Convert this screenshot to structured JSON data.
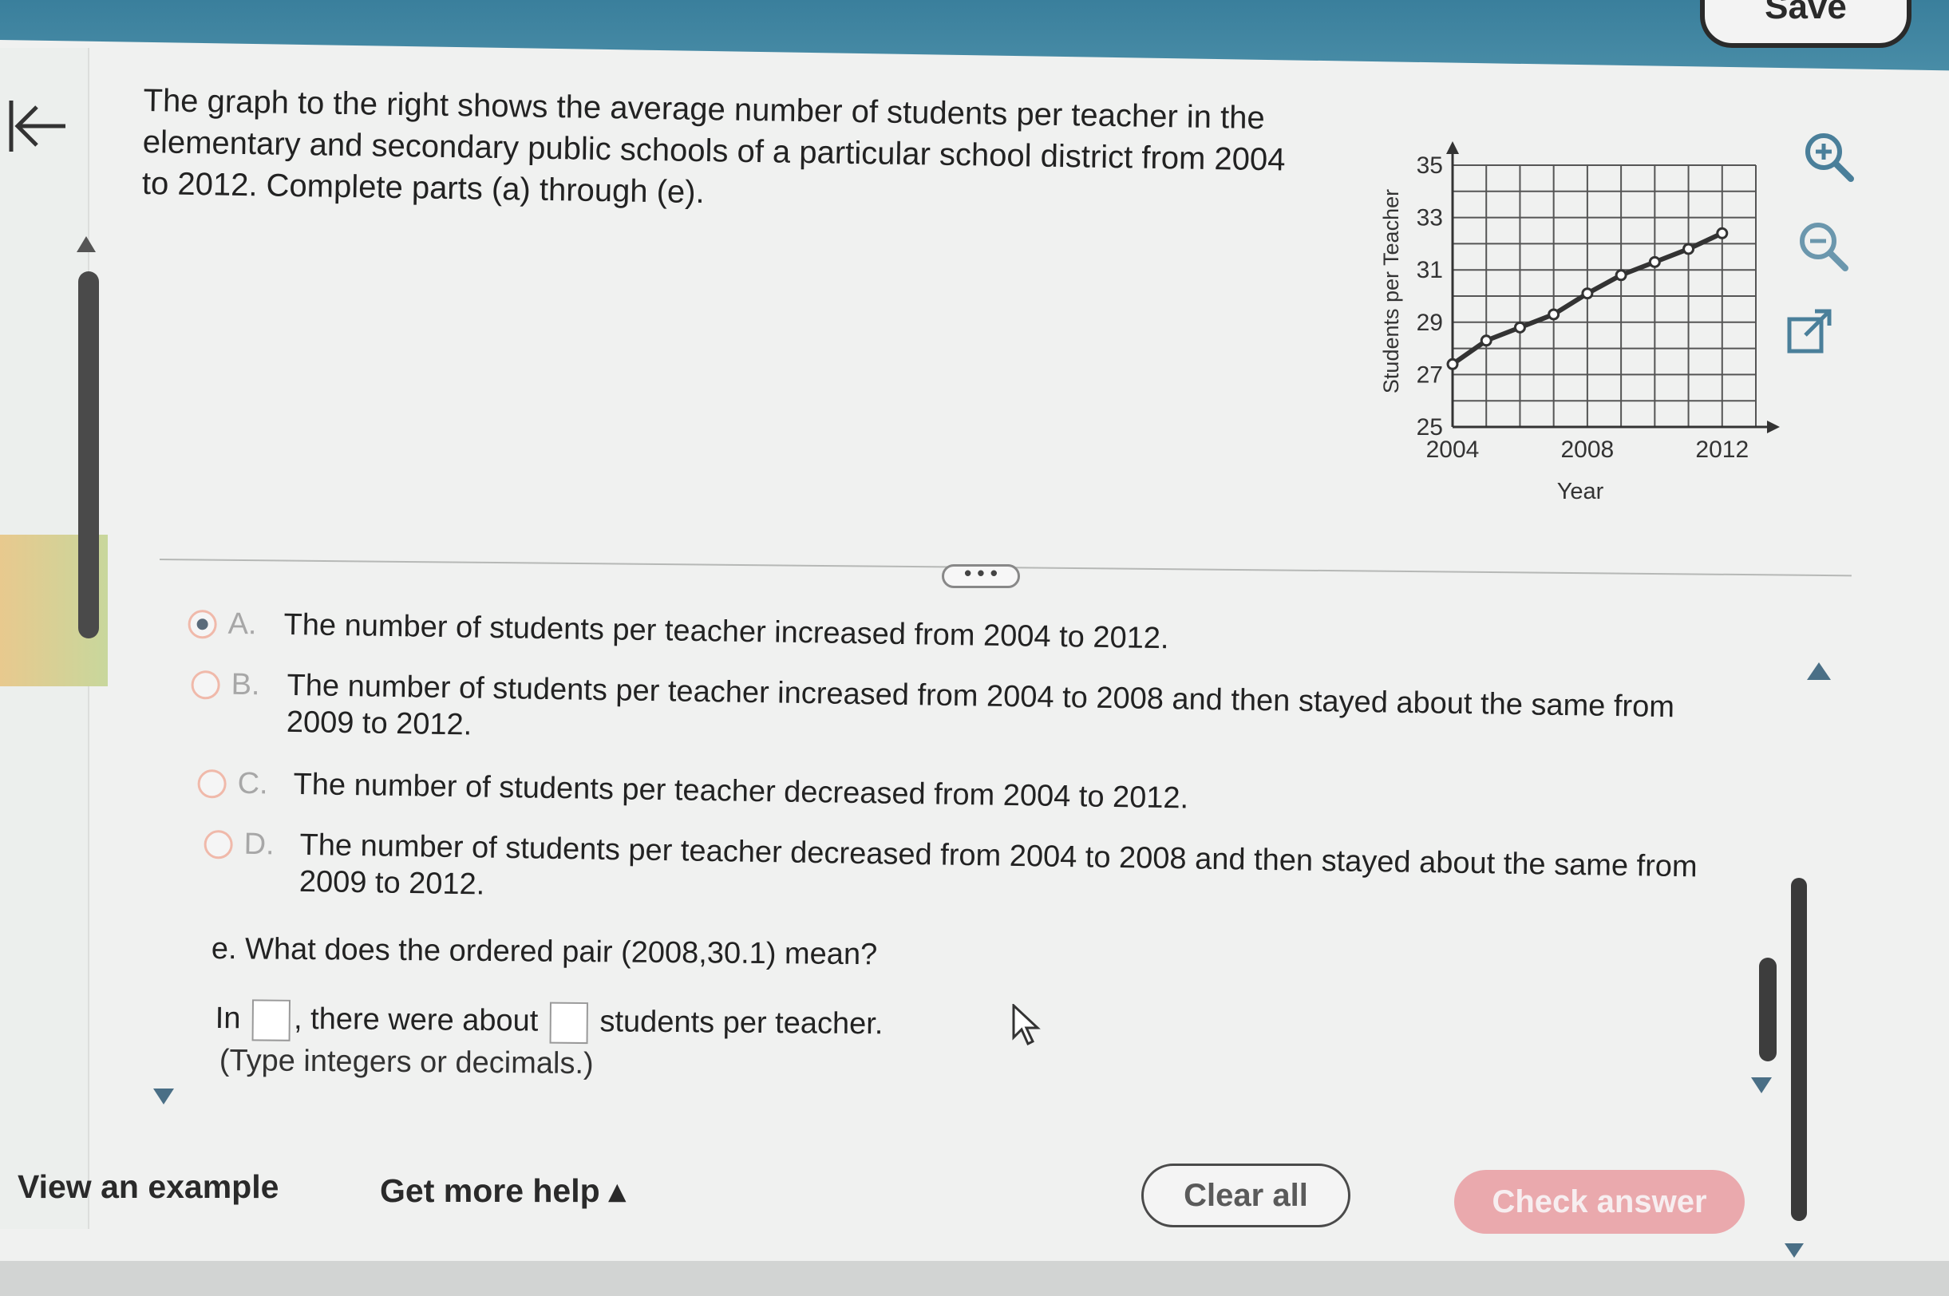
{
  "header": {
    "save_label": "Save"
  },
  "question": {
    "prompt": "The graph to the right shows the average number of students per teacher in the elementary and secondary public schools of a particular school district from 2004 to 2012. Complete parts (a) through (e)."
  },
  "divider_handle": "• • •",
  "options": [
    {
      "letter": "A.",
      "text": "The number of students per teacher increased from 2004 to 2012.",
      "selected": true
    },
    {
      "letter": "B.",
      "text": "The number of students per teacher increased from 2004 to 2008 and then stayed about the same from 2009 to 2012.",
      "selected": false
    },
    {
      "letter": "C.",
      "text": "The number of students per teacher decreased from 2004 to 2012.",
      "selected": false
    },
    {
      "letter": "D.",
      "text": "The number of students per teacher decreased from 2004 to 2008 and then stayed about the same from 2009 to 2012.",
      "selected": false
    }
  ],
  "part_e": {
    "question": "e. What does the ordered pair (2008,30.1) mean?",
    "answer_prefix": "In",
    "answer_middle": ", there were about",
    "answer_suffix": "students per teacher.",
    "hint": "(Type integers or decimals.)"
  },
  "footer": {
    "view_example": "View an example",
    "get_more_help": "Get more help ▴",
    "clear_all": "Clear all",
    "check_answer": "Check answer"
  },
  "icons": {
    "back": "back-arrow-icon",
    "zoom_in": "zoom-in-icon",
    "zoom_out": "zoom-out-icon",
    "popout": "popout-icon"
  },
  "colors": {
    "check_answer_bg": "#eaa9ad",
    "radio_border": "#f0b9aa",
    "topbar": "#4a8ea8"
  },
  "chart_data": {
    "type": "line",
    "x": [
      2004,
      2005,
      2006,
      2007,
      2008,
      2009,
      2010,
      2011,
      2012
    ],
    "values": [
      27.4,
      28.3,
      28.8,
      29.3,
      30.1,
      30.8,
      31.3,
      31.8,
      32.4
    ],
    "xlabel": "Year",
    "ylabel": "Students per Teacher",
    "xlim": [
      2004,
      2013
    ],
    "ylim": [
      25,
      35
    ],
    "xticks": [
      "2004",
      "2008",
      "2012"
    ],
    "yticks": [
      "25",
      "27",
      "29",
      "31",
      "33",
      "35"
    ],
    "grid": true
  }
}
